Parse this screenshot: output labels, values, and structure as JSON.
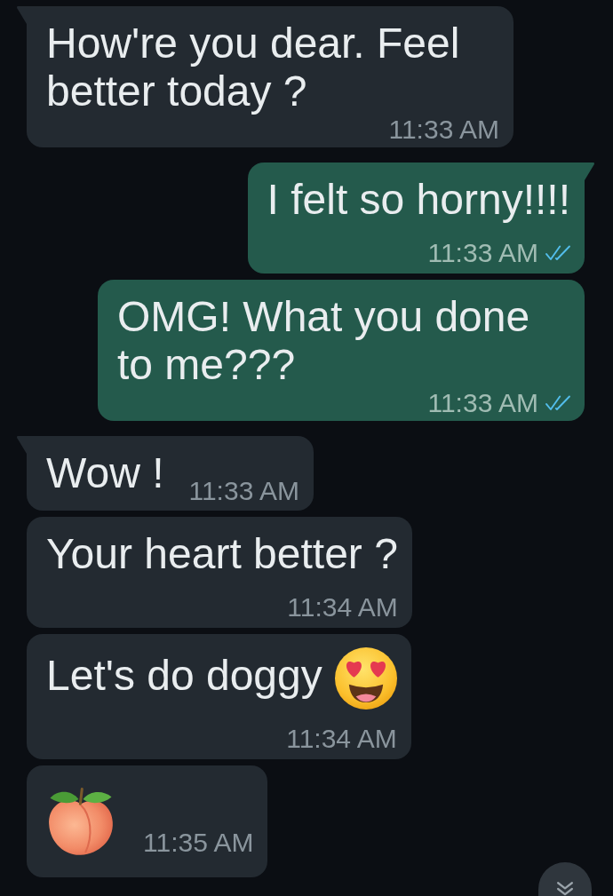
{
  "messages": [
    {
      "outgoing": false,
      "tail": true,
      "text": "How're you dear. Feel better today ?",
      "time": "11:33 AM"
    },
    {
      "outgoing": true,
      "tail": true,
      "text": "I felt so horny!!!!",
      "time": "11:33 AM",
      "read": true
    },
    {
      "outgoing": true,
      "tail": false,
      "text": "OMG! What you done to me???",
      "time": "11:33 AM",
      "read": true
    },
    {
      "outgoing": false,
      "tail": true,
      "text": "Wow !",
      "time": "11:33 AM"
    },
    {
      "outgoing": false,
      "tail": false,
      "text": "Your heart better ?",
      "time": "11:34 AM"
    },
    {
      "outgoing": false,
      "tail": false,
      "text": "Let's do doggy",
      "emoji": {
        "kind": "hearteyes"
      },
      "time": "11:34 AM"
    },
    {
      "outgoing": false,
      "tail": false,
      "emoji": {
        "kind": "peach"
      },
      "time": "11:35 AM"
    }
  ]
}
